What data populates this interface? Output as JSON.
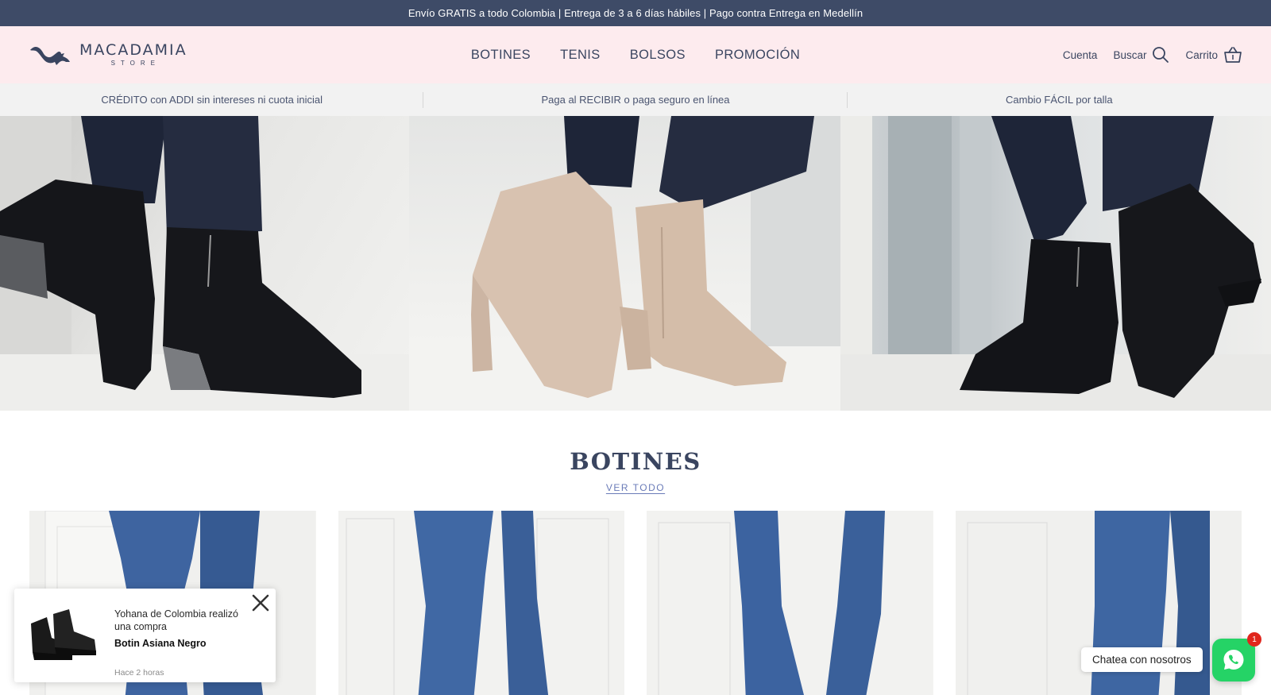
{
  "announcement": {
    "text": "Envío GRATIS a todo Colombia | Entrega de 3 a 6 días hábiles | Pago contra Entrega en Medellín"
  },
  "header": {
    "logo": {
      "name": "MACADAMIA",
      "sub": "STORE"
    },
    "nav": [
      {
        "label": "BOTINES"
      },
      {
        "label": "TENIS"
      },
      {
        "label": "BOLSOS"
      },
      {
        "label": "PROMOCIÓN"
      }
    ],
    "account_label": "Cuenta",
    "search_label": "Buscar",
    "cart_label": "Carrito"
  },
  "usp": [
    {
      "text": "CRÉDITO con ADDI sin intereses ni cuota inicial"
    },
    {
      "text": "Paga al RECIBIR o paga seguro en línea"
    },
    {
      "text": "Cambio FÁCIL por talla"
    }
  ],
  "collection": {
    "title": "BOTINES",
    "view_all": "VER TODO"
  },
  "toast": {
    "message": "Yohana de Colombia realizó una compra",
    "product": "Botin Asiana Negro",
    "time": "Hace 2 horas"
  },
  "chat": {
    "label": "Chatea con nosotros",
    "badge_count": "1"
  },
  "colors": {
    "announcement_bg": "#3e4b67",
    "header_bg": "#fdebee",
    "usp_bg": "#f2f2f2",
    "text": "#3a4560",
    "link": "#6a7bb8",
    "whatsapp": "#25d366"
  }
}
